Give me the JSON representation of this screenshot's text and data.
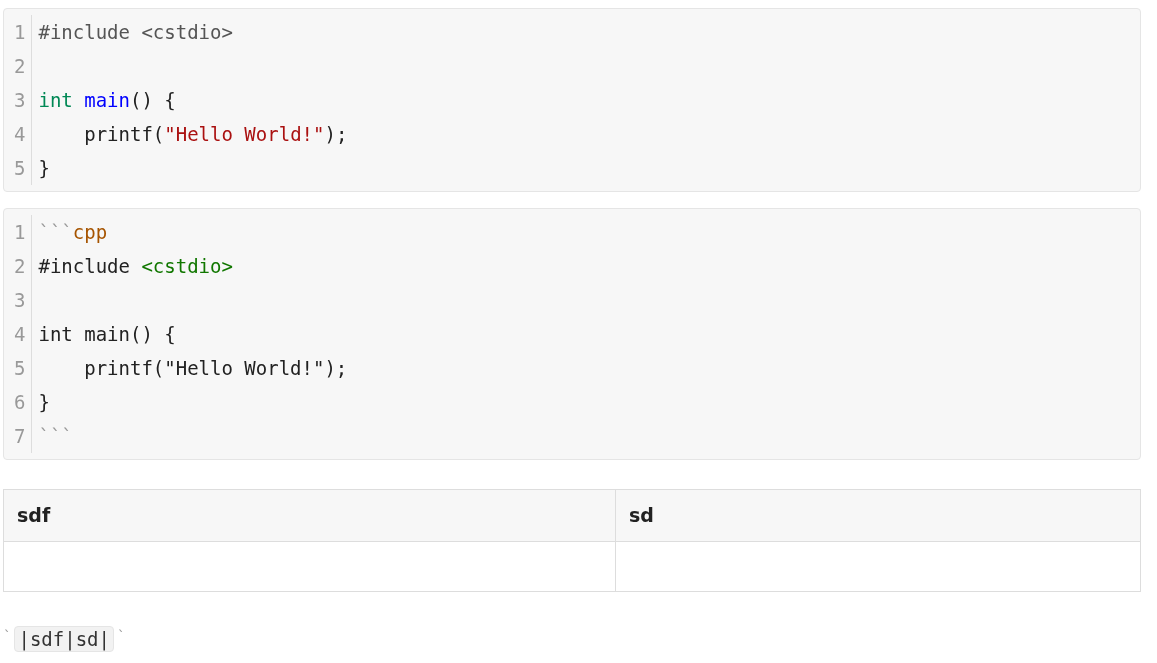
{
  "code_blocks": [
    {
      "lines": [
        {
          "number": "1",
          "tokens": [
            {
              "kind": "meta",
              "text": "#include <cstdio>"
            }
          ]
        },
        {
          "number": "2"
        },
        {
          "number": "3",
          "tokens": [
            {
              "kind": "keyword",
              "text": "int"
            },
            {
              "kind": "function",
              "text": " main"
            },
            {
              "kind": "plain",
              "text": "() {"
            }
          ]
        },
        {
          "number": "4",
          "tokens": [
            {
              "kind": "plain",
              "text": "    printf("
            },
            {
              "kind": "string",
              "text": "\"Hello World!\""
            },
            {
              "kind": "plain",
              "text": ");"
            }
          ]
        },
        {
          "number": "5",
          "tokens": [
            {
              "kind": "plain",
              "text": "}"
            }
          ]
        }
      ]
    },
    {
      "lines": [
        {
          "number": "1",
          "tokens": [
            {
              "kind": "fence",
              "text": "```"
            },
            {
              "kind": "lang",
              "text": "cpp"
            }
          ]
        },
        {
          "number": "2",
          "tokens": [
            {
              "kind": "plain",
              "text": "#include "
            },
            {
              "kind": "header",
              "text": "<cstdio>"
            }
          ]
        },
        {
          "number": "3"
        },
        {
          "number": "4",
          "tokens": [
            {
              "kind": "plain",
              "text": "int main() {"
            }
          ]
        },
        {
          "number": "5",
          "tokens": [
            {
              "kind": "plain",
              "text": "    printf(\"Hello World!\");"
            }
          ]
        },
        {
          "number": "6",
          "tokens": [
            {
              "kind": "plain",
              "text": "}"
            }
          ]
        },
        {
          "number": "7",
          "tokens": [
            {
              "kind": "fence",
              "text": "```"
            }
          ]
        }
      ]
    }
  ],
  "table": {
    "columns": [
      "sdf",
      "sd"
    ]
  },
  "paragraph": [
    {
      "kind": "mark",
      "text": "`"
    },
    {
      "kind": "code",
      "text": "|sdf|sd|"
    },
    {
      "kind": "mark",
      "text": "`"
    }
  ]
}
